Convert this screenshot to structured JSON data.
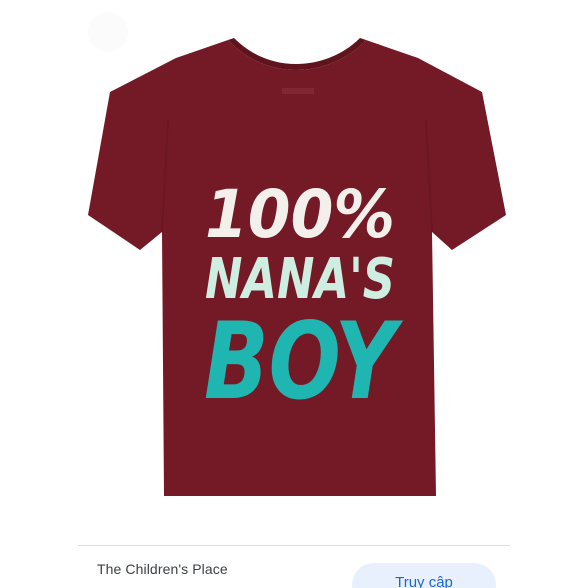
{
  "product": {
    "print_line1": "100%",
    "print_line2": "NANA'S",
    "print_line3": "BOY",
    "colors": {
      "shirt": "#741a26",
      "shirt_shadow": "#5f131d",
      "line1": "#f3efea",
      "line2": "#cdeee0",
      "line3": "#1fb6b1"
    }
  },
  "source": {
    "name": "The Children's Place"
  },
  "actions": {
    "visit_label": "Truy cập"
  },
  "colors": {
    "accent": "#1967d2",
    "button_bg": "#e8f0fe",
    "divider": "#dadce0"
  }
}
